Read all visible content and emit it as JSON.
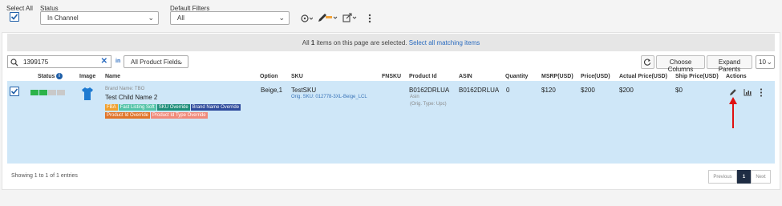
{
  "filters": {
    "select_all_label": "Select All",
    "status_label": "Status",
    "status_value": "In Channel",
    "default_filters_label": "Default Filters",
    "default_filters_value": "All"
  },
  "banner": {
    "text_prefix": "All ",
    "count": "1",
    "text_suffix": " items on this page are selected.",
    "select_all_link": "Select all matching items"
  },
  "search": {
    "value": "1399175",
    "in_label": "in",
    "field_value": "All Product Fields"
  },
  "toolbar": {
    "choose_columns": "Choose Columns",
    "expand_parents": "Expand Parents",
    "page_size": "10"
  },
  "columns": {
    "status": "Status",
    "image": "Image",
    "name": "Name",
    "option": "Option",
    "sku": "SKU",
    "fnsku": "FNSKU",
    "product_id": "Product Id",
    "asin": "ASIN",
    "quantity": "Quantity",
    "msrp": "MSRP(USD)",
    "price": "Price(USD)",
    "actual_price": "Actual Price(USD)",
    "ship_price": "Ship Price(USD)",
    "actions": "Actions"
  },
  "row": {
    "brand_name": "Brand Name: TBO",
    "name": "Test Child Name 2",
    "tags": [
      "FBA",
      "Fast Listing Soft",
      "SKU Override",
      "Brand Name Override",
      "Product Id Override",
      "Product Id Type Override"
    ],
    "option": "Beige,1",
    "sku": "TestSKU",
    "orig_sku": "Orig. SKU: 012778-3XL-Beige_LCL",
    "product_id": "B0162DRLUA",
    "product_id_type": "Asin",
    "orig_type": "(Orig. Type: Upc)",
    "asin": "B0162DRLUA",
    "quantity": "0",
    "msrp": "$120",
    "price": "$200",
    "actual_price": "$200",
    "ship_price": "$0"
  },
  "footer": {
    "showing": "Showing 1 to 1 of 1 entries",
    "previous": "Previous",
    "page": "1",
    "next": "Next"
  },
  "colors": {
    "accent": "#1f5fa8",
    "row_selected": "#cfe7f8",
    "status_green": "#2db34a",
    "arrow_red": "#e01010"
  }
}
